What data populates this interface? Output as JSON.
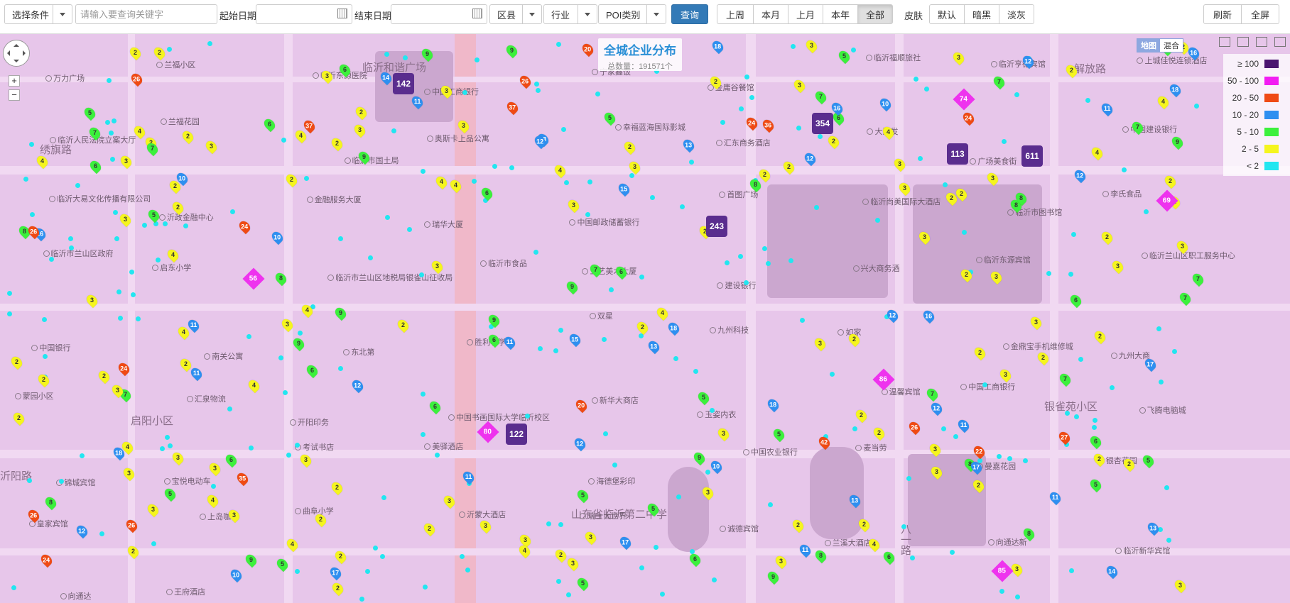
{
  "toolbar": {
    "condition_select": "选择条件",
    "search_placeholder": "请输入要查询关键字",
    "start_date_label": "起始日期",
    "end_date_label": "结束日期",
    "district": "区县",
    "industry": "行业",
    "poi_type": "POI类别",
    "query_button": "查询",
    "period_buttons": [
      "上周",
      "本月",
      "上月",
      "本年",
      "全部"
    ],
    "period_active": "全部",
    "skin_label": "皮肤",
    "skin_buttons": [
      "默认",
      "暗黑",
      "淡灰"
    ],
    "refresh": "刷新",
    "fullscreen": "全屏"
  },
  "map": {
    "title": "全城企业分布",
    "total": "总数量：191571个",
    "maptype": [
      "地图",
      "混合"
    ],
    "zoom_in": "+",
    "zoom_out": "−",
    "legend": [
      {
        "label": "≥ 100",
        "color": "#4b1470"
      },
      {
        "label": "50 - 100",
        "color": "#f21cf2"
      },
      {
        "label": "20 - 50",
        "color": "#ef4a14"
      },
      {
        "label": "10 - 20",
        "color": "#2e8ff0"
      },
      {
        "label": "5 - 10",
        "color": "#3cf03c"
      },
      {
        "label": "2 - 5",
        "color": "#f5f51e"
      },
      {
        "label": "< 2",
        "color": "#22e6f0"
      }
    ],
    "areas": [
      "临沂和谐广场",
      "解放路",
      "启阳小区",
      "银雀苑小区",
      "山东省临沂第二中学",
      "绣旗路",
      "八一路",
      "沂阳路"
    ],
    "places": [
      "万力广场",
      "兰福小区",
      "临沂东源医院",
      "中国工商银行",
      "宁家鑫饭",
      "金庸谷餐馆",
      "临沂福顺旅社",
      "临沂亨德宾馆",
      "上城佳悦连锁酒店",
      "临沂人民法院立案大厅",
      "兰福花园",
      "临沂市国土局",
      "奥斯卡上品公寓",
      "幸福蓝海国际影城",
      "汇东商务酒店",
      "大润发",
      "广场美食街",
      "中国建设银行",
      "临沂大易文化传播有限公司",
      "沂政金融中心",
      "金融服务大厦",
      "瑞华大厦",
      "中国邮政储蓄银行",
      "首图广场",
      "临沂尚美国际大酒店",
      "临沂市图书馆",
      "李氏食品",
      "临沂市兰山区政府",
      "启东小学",
      "临沂市兰山区地税局银雀山征收局",
      "临沂市食品",
      "工艺美术大厦",
      "建设银行",
      "兴大商务酒",
      "临沂东源宾馆",
      "临沂兰山区职工服务中心",
      "中国银行",
      "南关公寓",
      "东北第",
      "胜利小学",
      "双星",
      "九州科技",
      "如家",
      "金鼎宝手机维修城",
      "九州大商",
      "蒙园小区",
      "汇泉物流",
      "开阳印务",
      "中国书画国际大学临沂校区",
      "新华大商店",
      "玉姿内衣",
      "温馨宾馆",
      "中国工商银行",
      "飞腾电脑城",
      "锦城宾馆",
      "宝悦电动车",
      "考试书店",
      "美驿酒店",
      "海德堡彩印",
      "中国农业银行",
      "麦当劳",
      "曼嘉花园",
      "银杏花园",
      "皇家宾馆",
      "上岛咖啡",
      "曲阜小学",
      "沂蒙大酒店",
      "瑞士大世界",
      "诚德宾馆",
      "兰溪大酒店",
      "向通达新",
      "临沂新华宾馆",
      "向通达",
      "王府酒店"
    ],
    "clusters": [
      {
        "value": "142"
      },
      {
        "value": "354"
      },
      {
        "value": "113"
      },
      {
        "value": "611"
      },
      {
        "value": "243"
      },
      {
        "value": "122"
      }
    ],
    "diamonds": [
      {
        "value": "56"
      },
      {
        "value": "74"
      },
      {
        "value": "69"
      },
      {
        "value": "86"
      },
      {
        "value": "80"
      },
      {
        "value": "85"
      }
    ],
    "pins": [
      "9",
      "3",
      "4",
      "4",
      "2",
      "9",
      "11",
      "2",
      "7",
      "24",
      "2",
      "2",
      "3",
      "9",
      "36",
      "2",
      "4",
      "5",
      "18",
      "35",
      "2",
      "6",
      "9",
      "6",
      "3",
      "2",
      "2",
      "7",
      "3",
      "3",
      "2",
      "11",
      "3",
      "24",
      "3",
      "2",
      "15",
      "7",
      "4",
      "5",
      "3",
      "4",
      "5",
      "3",
      "18",
      "3",
      "2",
      "2",
      "6",
      "18",
      "5",
      "3",
      "2",
      "6",
      "18",
      "7",
      "37",
      "5",
      "4",
      "3",
      "6",
      "8",
      "11",
      "4",
      "2",
      "9",
      "8",
      "6",
      "16",
      "2",
      "2",
      "3",
      "2",
      "5",
      "3",
      "6",
      "3",
      "2",
      "13",
      "8",
      "2",
      "3",
      "3",
      "3",
      "8",
      "13",
      "7",
      "3",
      "6",
      "8",
      "9",
      "2",
      "3",
      "3",
      "5",
      "3",
      "12",
      "4",
      "6",
      "16",
      "9",
      "3",
      "2",
      "4",
      "24",
      "4",
      "17",
      "12",
      "12",
      "2",
      "5",
      "11",
      "2",
      "12",
      "42",
      "2",
      "3",
      "26",
      "10",
      "24",
      "17",
      "6",
      "11",
      "37",
      "20",
      "2",
      "3",
      "3",
      "3",
      "2",
      "2",
      "16",
      "12",
      "13",
      "26",
      "2",
      "11",
      "11",
      "4",
      "8",
      "7",
      "3",
      "9",
      "2",
      "5",
      "6",
      "8",
      "17",
      "3",
      "16",
      "2",
      "3",
      "2",
      "7",
      "10",
      "4",
      "6",
      "11",
      "8",
      "5",
      "2",
      "12",
      "3",
      "4",
      "5",
      "6",
      "7",
      "17",
      "12",
      "24",
      "3",
      "2",
      "3",
      "26",
      "2",
      "3",
      "22",
      "14",
      "18",
      "3",
      "2",
      "13",
      "6",
      "3",
      "9",
      "3",
      "5",
      "3",
      "11",
      "26",
      "3",
      "7",
      "9",
      "2",
      "2",
      "2",
      "4",
      "3",
      "7",
      "26",
      "2",
      "10",
      "15",
      "27",
      "2",
      "12",
      "10",
      "3",
      "4",
      "2",
      "4",
      "2",
      "6",
      "3",
      "5",
      "12",
      "20",
      "4",
      "3",
      "2",
      "2",
      "8",
      "26",
      "4",
      "2",
      "4",
      "7",
      "14",
      "3",
      "2",
      "9",
      "10",
      "13",
      "2",
      "2"
    ]
  }
}
